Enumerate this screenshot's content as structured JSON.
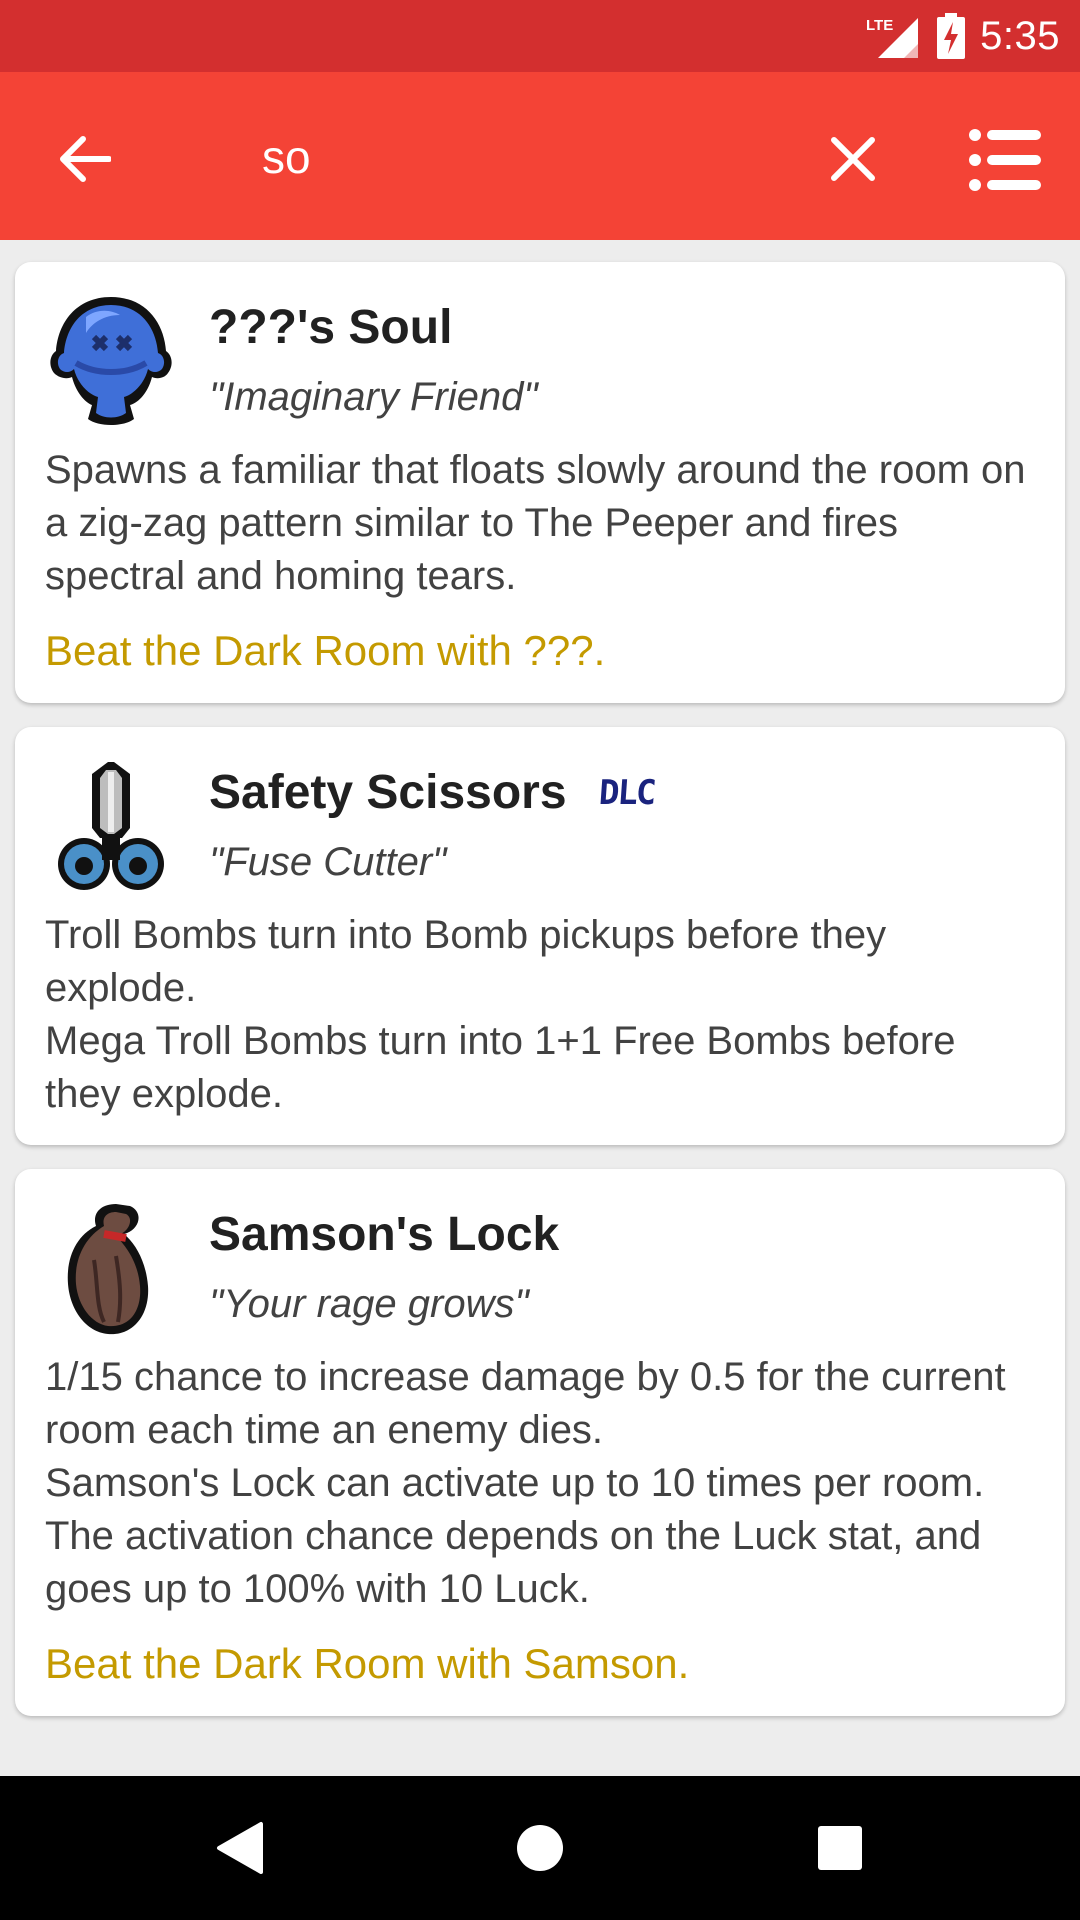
{
  "status_bar": {
    "network_label": "LTE",
    "time": "5:35"
  },
  "app_bar": {
    "search_value": "so",
    "back_icon": "arrow-back-icon",
    "clear_icon": "close-icon",
    "menu_icon": "list-menu-icon"
  },
  "items": [
    {
      "name": "???'s Soul",
      "quote": "\"Imaginary Friend\"",
      "dlc": "",
      "description": [
        "Spawns a familiar that floats slowly around the room on a zig-zag pattern similar to The Peeper and fires spectral and homing tears."
      ],
      "unlock": "Beat the Dark Room with ???.",
      "icon": "blue-soul-sprite-icon"
    },
    {
      "name": "Safety Scissors",
      "quote": "\"Fuse Cutter\"",
      "dlc": "DLC",
      "description": [
        "Troll Bombs turn into Bomb pickups before they explode.",
        "Mega Troll Bombs turn into 1+1 Free Bombs before they explode."
      ],
      "unlock": "",
      "icon": "scissors-sprite-icon"
    },
    {
      "name": "Samson's Lock",
      "quote": "\"Your rage grows\"",
      "dlc": "",
      "description": [
        "1/15 chance to increase damage by 0.5 for the current room each time an enemy dies.",
        "Samson's Lock can activate up to 10 times per room.",
        "The activation chance depends on the Luck stat, and goes up to 100% with 10 Luck."
      ],
      "unlock": "Beat the Dark Room with Samson.",
      "icon": "hair-lock-sprite-icon"
    }
  ],
  "nav_bar": {
    "back_icon": "nav-back-triangle-icon",
    "home_icon": "nav-home-circle-icon",
    "recents_icon": "nav-recents-square-icon"
  },
  "colors": {
    "status_bar": "#d32f2f",
    "app_bar": "#f44336",
    "unlock_text": "#c49a00",
    "dlc_badge": "#1a237e"
  }
}
